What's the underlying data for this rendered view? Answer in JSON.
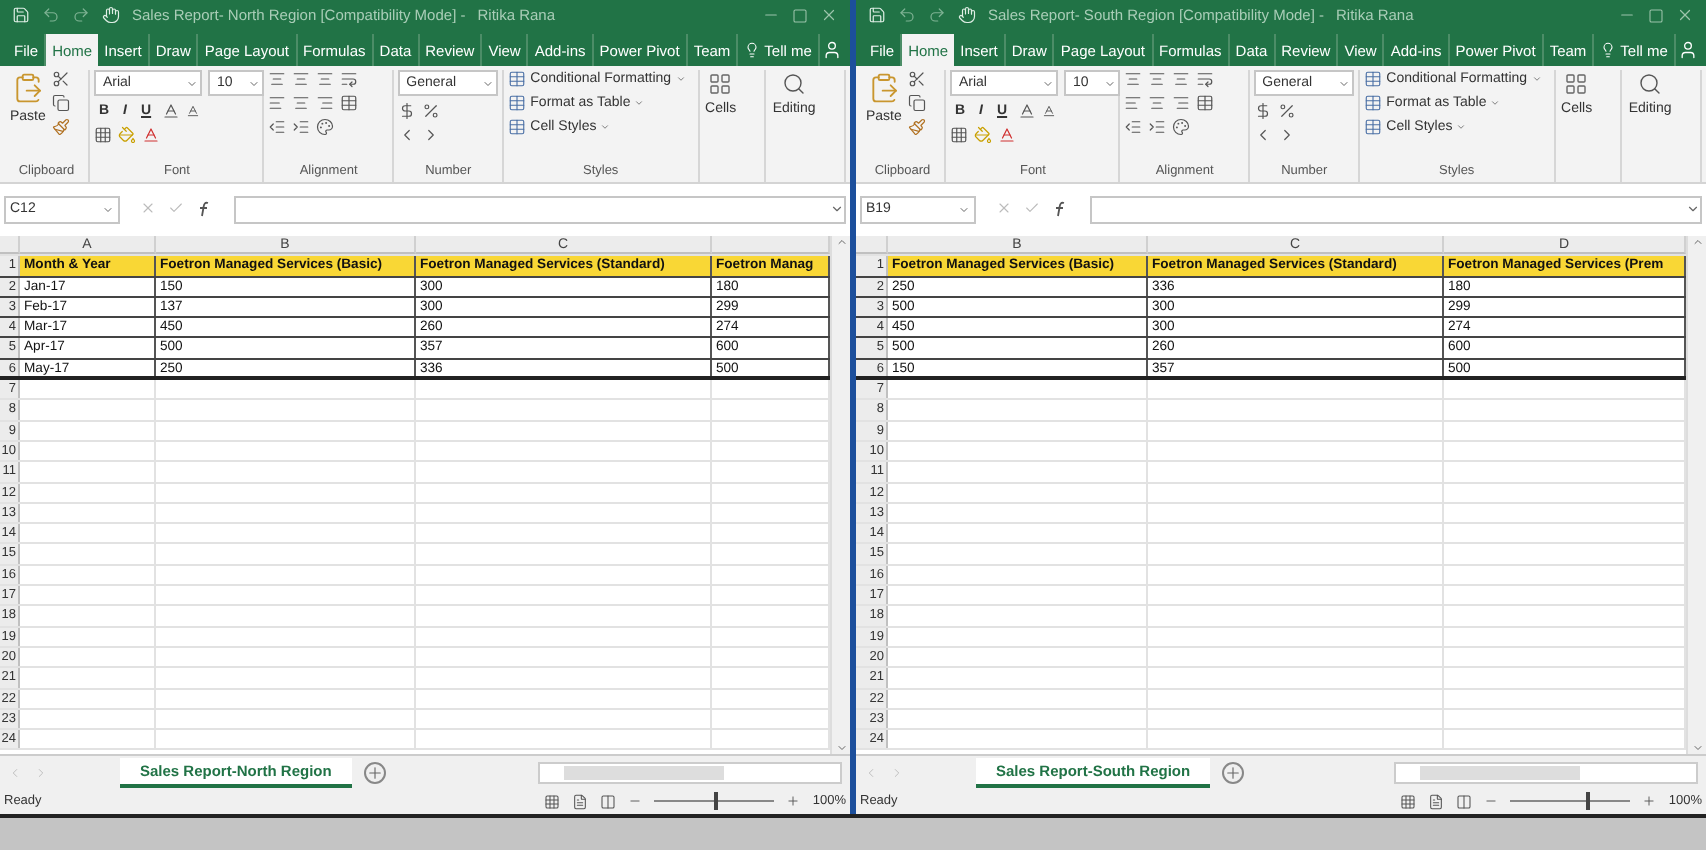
{
  "windows": [
    {
      "title": "Sales Report- North Region  [Compatibility Mode]  -",
      "user": "Ritika Rana",
      "tabs": [
        {
          "label": "File",
          "selected": false
        },
        {
          "label": "Home",
          "selected": true
        },
        {
          "label": "Insert",
          "selected": false
        },
        {
          "label": "Draw",
          "selected": false
        },
        {
          "label": "Page Layout",
          "selected": false
        },
        {
          "label": "Formulas",
          "selected": false
        },
        {
          "label": "Data",
          "selected": false
        },
        {
          "label": "Review",
          "selected": false
        },
        {
          "label": "View",
          "selected": false
        },
        {
          "label": "Add-ins",
          "selected": false
        },
        {
          "label": "Power Pivot",
          "selected": false
        },
        {
          "label": "Team",
          "selected": false
        },
        {
          "label": "Tell me",
          "selected": false
        }
      ],
      "ribbon": {
        "paste": "Paste",
        "font_name": "Arial",
        "font_size": "10",
        "bold": "B",
        "italic": "I",
        "underline": "U",
        "number_format": "General",
        "styles": [
          "Conditional Formatting",
          "Format as Table",
          "Cell Styles"
        ],
        "cells": "Cells",
        "editing": "Editing",
        "groups": [
          "Clipboard",
          "Font",
          "Alignment",
          "Number",
          "Styles"
        ]
      },
      "name_box": "C12",
      "columns": [
        "A",
        "B",
        "C",
        ""
      ],
      "rows": [
        {
          "number": "1",
          "kind": "header",
          "cells": [
            "Month & Year",
            "Foetron Managed Services (Basic)",
            "Foetron Managed Services (Standard)",
            "Foetron Manag"
          ]
        },
        {
          "number": "2",
          "kind": "data",
          "cells": [
            "Jan-17",
            "150",
            "300",
            "180"
          ]
        },
        {
          "number": "3",
          "kind": "data",
          "cells": [
            "Feb-17",
            "137",
            "300",
            "299"
          ]
        },
        {
          "number": "4",
          "kind": "data",
          "cells": [
            "Mar-17",
            "450",
            "260",
            "274"
          ]
        },
        {
          "number": "5",
          "kind": "data",
          "cells": [
            "Apr-17",
            "500",
            "357",
            "600"
          ]
        },
        {
          "number": "6",
          "kind": "last",
          "cells": [
            "May-17",
            "250",
            "336",
            "500"
          ]
        },
        {
          "number": "7"
        },
        {
          "number": "8"
        },
        {
          "number": "9"
        },
        {
          "number": "10"
        },
        {
          "number": "11"
        },
        {
          "number": "12"
        },
        {
          "number": "13"
        },
        {
          "number": "14"
        },
        {
          "number": "15"
        },
        {
          "number": "16"
        },
        {
          "number": "17"
        },
        {
          "number": "18"
        },
        {
          "number": "19"
        },
        {
          "number": "20"
        },
        {
          "number": "21"
        },
        {
          "number": "22"
        },
        {
          "number": "23"
        },
        {
          "number": "24"
        }
      ],
      "sheet_tab": "Sales Report-North Region",
      "status": "Ready",
      "zoom": "100%",
      "zoom_slider": {
        "level": 0.5
      }
    },
    {
      "title": "Sales Report- South Region  [Compatibility Mode]  -",
      "user": "Ritika Rana",
      "tabs": [
        {
          "label": "File",
          "selected": false
        },
        {
          "label": "Home",
          "selected": true
        },
        {
          "label": "Insert",
          "selected": false
        },
        {
          "label": "Draw",
          "selected": false
        },
        {
          "label": "Page Layout",
          "selected": false
        },
        {
          "label": "Formulas",
          "selected": false
        },
        {
          "label": "Data",
          "selected": false
        },
        {
          "label": "Review",
          "selected": false
        },
        {
          "label": "View",
          "selected": false
        },
        {
          "label": "Add-ins",
          "selected": false
        },
        {
          "label": "Power Pivot",
          "selected": false
        },
        {
          "label": "Team",
          "selected": false
        },
        {
          "label": "Tell me",
          "selected": false
        }
      ],
      "ribbon": {
        "paste": "Paste",
        "font_name": "Arial",
        "font_size": "10",
        "bold": "B",
        "italic": "I",
        "underline": "U",
        "number_format": "General",
        "styles": [
          "Conditional Formatting",
          "Format as Table",
          "Cell Styles"
        ],
        "cells": "Cells",
        "editing": "Editing",
        "groups": [
          "Clipboard",
          "Font",
          "Alignment",
          "Number",
          "Styles"
        ]
      },
      "name_box": "B19",
      "columns": [
        "B",
        "C",
        "D"
      ],
      "rows": [
        {
          "number": "1",
          "kind": "header",
          "cells": [
            "Foetron Managed Services (Basic)",
            "Foetron Managed Services (Standard)",
            "Foetron Managed Services (Prem"
          ]
        },
        {
          "number": "2",
          "kind": "data",
          "cells": [
            "250",
            "336",
            "180"
          ]
        },
        {
          "number": "3",
          "kind": "data",
          "cells": [
            "500",
            "300",
            "299"
          ]
        },
        {
          "number": "4",
          "kind": "data",
          "cells": [
            "450",
            "300",
            "274"
          ]
        },
        {
          "number": "5",
          "kind": "data",
          "cells": [
            "500",
            "260",
            "600"
          ]
        },
        {
          "number": "6",
          "kind": "last",
          "cells": [
            "150",
            "357",
            "500"
          ]
        },
        {
          "number": "7"
        },
        {
          "number": "8"
        },
        {
          "number": "9"
        },
        {
          "number": "10"
        },
        {
          "number": "11"
        },
        {
          "number": "12"
        },
        {
          "number": "13"
        },
        {
          "number": "14"
        },
        {
          "number": "15"
        },
        {
          "number": "16"
        },
        {
          "number": "17"
        },
        {
          "number": "18"
        },
        {
          "number": "19"
        },
        {
          "number": "20"
        },
        {
          "number": "21"
        },
        {
          "number": "22"
        },
        {
          "number": "23"
        },
        {
          "number": "24"
        }
      ],
      "sheet_tab": "Sales Report-South Region",
      "status": "Ready",
      "zoom": "100%",
      "zoom_slider": {
        "level": 0.62
      }
    }
  ]
}
